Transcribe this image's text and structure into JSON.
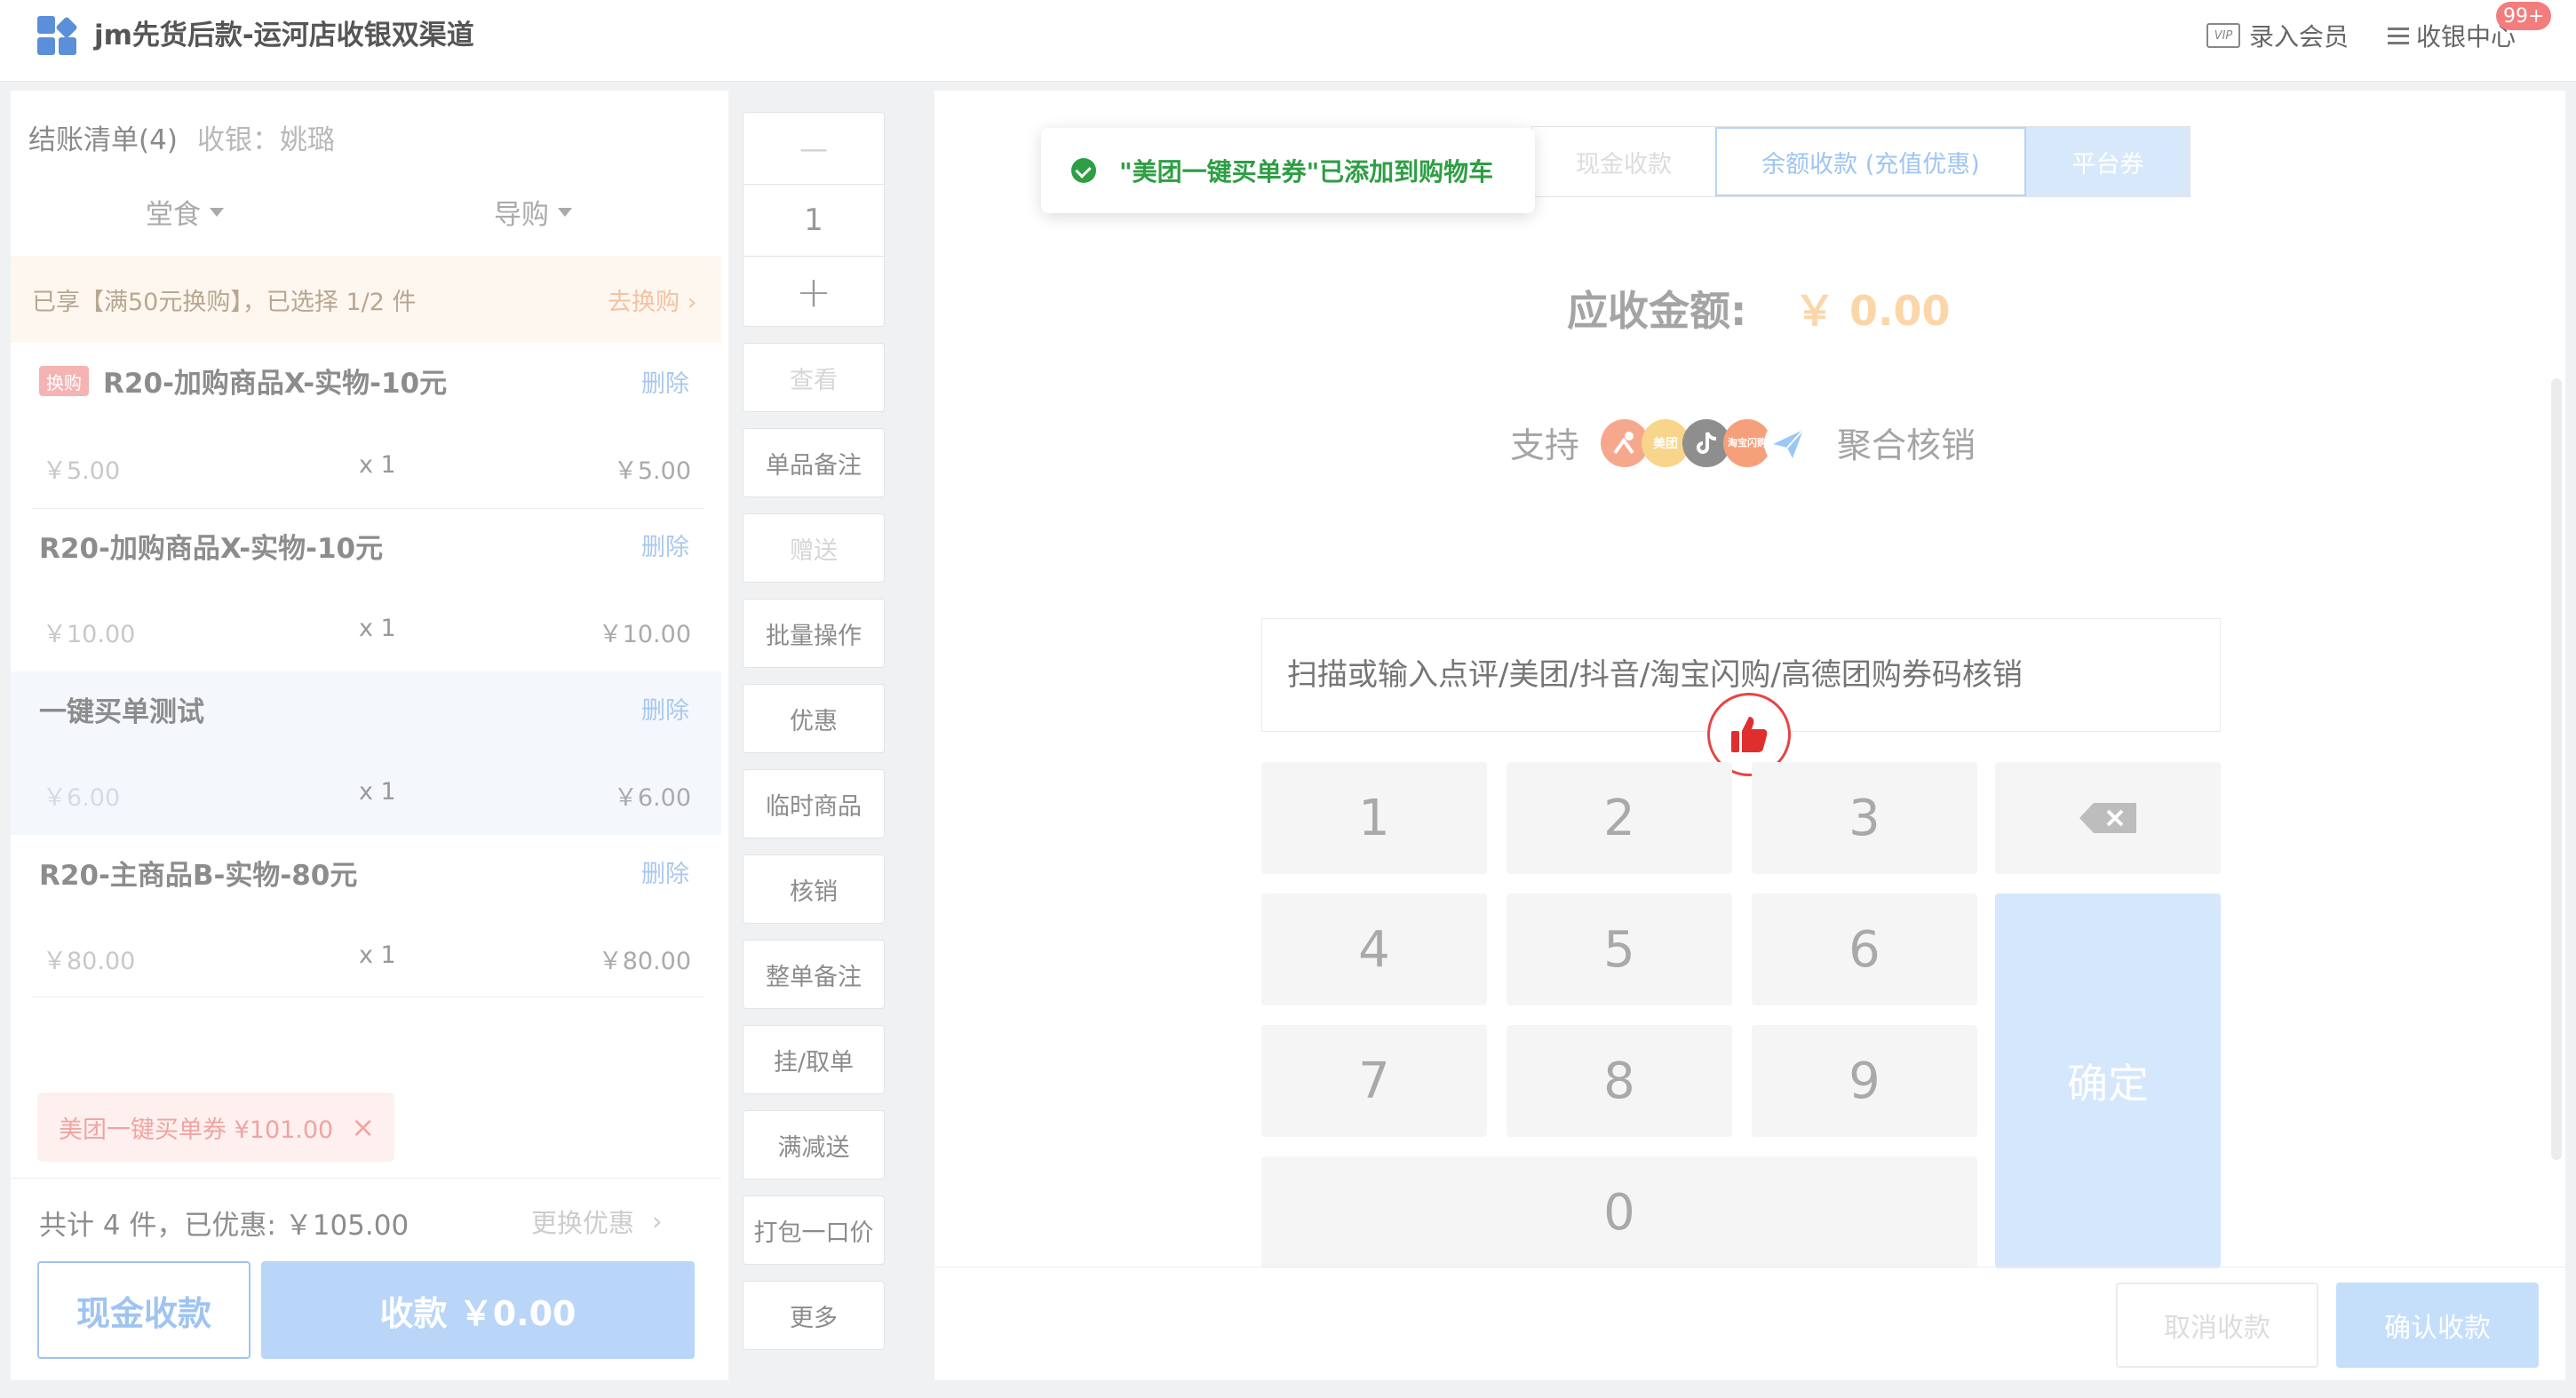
{
  "header": {
    "title": "jm先货后款-运河店收银双渠道",
    "member_label": "录入会员",
    "vip_text": "VIP",
    "center_label": "收银中心",
    "badge": "99+"
  },
  "order": {
    "title": "结账清单(4)",
    "cashier": "收银：姚璐",
    "dropdown_dine": "堂食",
    "dropdown_guide": "导购",
    "promo_text": "已享【满50元换购】，已选择 1/2 件",
    "promo_link": "去换购",
    "delete_label": "删除",
    "items": [
      {
        "tag": "换购",
        "name": "R20-加购商品X-实物-10元",
        "price": "￥5.00",
        "qty": "x 1",
        "total": "￥5.00"
      },
      {
        "name": "R20-加购商品X-实物-10元",
        "price": "￥10.00",
        "qty": "x 1",
        "total": "￥10.00"
      },
      {
        "name": "一键买单测试",
        "price": "￥6.00",
        "qty": "x 1",
        "total": "￥6.00"
      },
      {
        "name": "R20-主商品B-实物-80元",
        "price": "￥80.00",
        "qty": "x 1",
        "total": "￥80.00"
      }
    ],
    "coupon": "美团一键买单券 ¥101.00",
    "summary": "共计 4 件，已优惠: ￥105.00",
    "change_discount": "更换优惠",
    "cash_button": "现金收款",
    "pay_button": "收款 ￥0.00"
  },
  "side": {
    "minus": "—",
    "qty": "1",
    "plus": "+",
    "buttons": [
      "查看",
      "单品备注",
      "赠送",
      "批量操作",
      "优惠",
      "临时商品",
      "核销",
      "整单备注",
      "挂/取单",
      "满减送",
      "打包一口价",
      "更多"
    ]
  },
  "payment": {
    "tabs": [
      "现金收款",
      "余额收款 (充值优惠)",
      "平台券"
    ],
    "toast": "\"美团一键买单券\"已添加到购物车",
    "due_label": "应收金额:",
    "due_value": "￥ 0.00",
    "support_prefix": "支持",
    "support_suffix": "聚合核销",
    "logo_meituan": "美团",
    "logo_taobao": "淘宝闪购",
    "input_placeholder": "扫描或输入点评/美团/抖音/淘宝闪购/高德团购券码核销",
    "keys": [
      "1",
      "2",
      "3",
      "4",
      "5",
      "6",
      "7",
      "8",
      "9",
      "0"
    ],
    "confirm_key": "确定",
    "cancel_button": "取消收款",
    "confirm_button": "确认收款"
  },
  "colors": {
    "accent": "#9fc4f2",
    "success": "#2e9e44",
    "danger": "#e64545"
  },
  "icons": [
    "app-grid-icon",
    "vip-icon",
    "menu-icon",
    "check-circle-icon",
    "thumbs-up-icon",
    "backspace-icon",
    "close-icon",
    "chevron-right-icon"
  ]
}
